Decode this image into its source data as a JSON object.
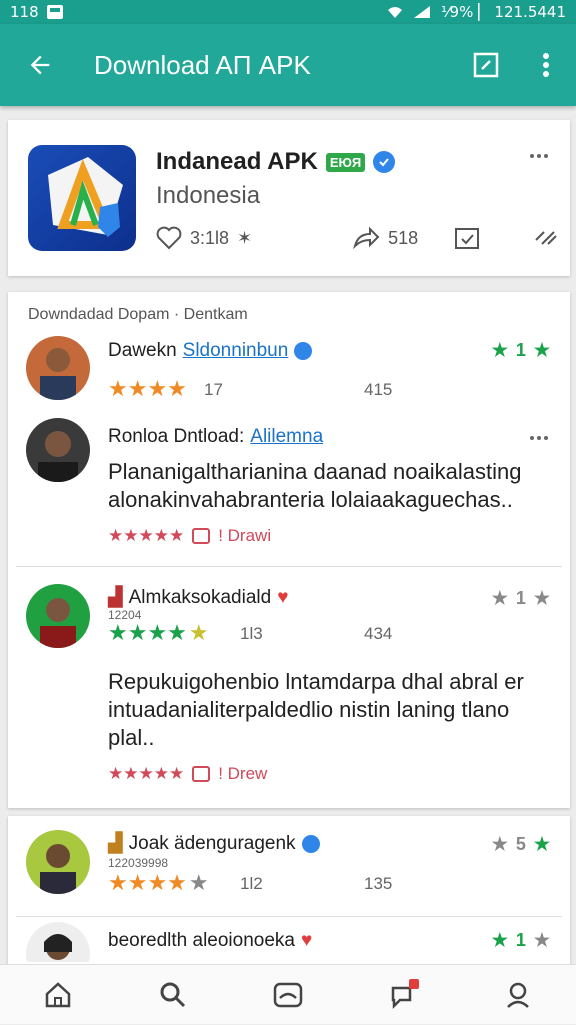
{
  "status": {
    "left_time": "118",
    "right_text": "⅟9% ▏ 121.5441"
  },
  "appbar": {
    "title": "Download AΠ APK"
  },
  "app": {
    "name": "Indanead APK",
    "tag": "ЕЮЯ",
    "subtitle": "Indonesia",
    "likes": "3:1l8",
    "share": "518"
  },
  "list": {
    "header": "Downdadad Dopam · Dentkam"
  },
  "reviews": [
    {
      "name": "Dawekn",
      "link": "Sldonninbun",
      "rating_count": "17",
      "helpful": "415",
      "score": "1"
    },
    {
      "name": "Ronloa Dntload:",
      "link": "Alilemna",
      "text1": "Plananigaltharianina daanad noaikalasting",
      "text2": "alonakinvahabranteria lolaiaakaguechas..",
      "foot": "! Drawi"
    },
    {
      "name": "Almkaksokadiald",
      "sub": "12204",
      "rating_count": "1l3",
      "helpful": "434",
      "score": "1",
      "text1": "Repukuigohenbio lntamdarpa dhal abral er",
      "text2": "intuadanialiterpaldedlio nistin laning tlano",
      "text3": "plal..",
      "foot": "! Drew"
    },
    {
      "name": "Joak ädenguragenk",
      "sub": "122039998",
      "rating_count": "1l2",
      "helpful": "135",
      "score": "5"
    },
    {
      "name": "beoredlth aleoionoeka",
      "score": "1"
    }
  ],
  "colors": {
    "teal": "#21a898",
    "orange": "#f08a24",
    "green": "#19a24a",
    "accent_red": "#d04a5a"
  }
}
